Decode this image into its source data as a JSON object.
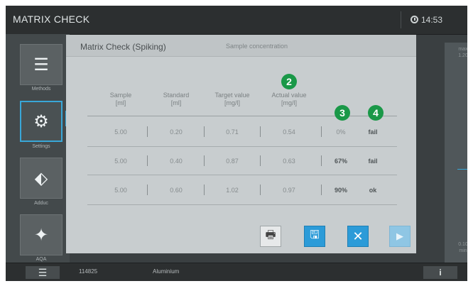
{
  "app": {
    "title": "MATRIX CHECK",
    "time": "14:53"
  },
  "sidebar": {
    "items": [
      {
        "label": "Methods",
        "icon": "list-icon",
        "glyph": "☰"
      },
      {
        "label": "Settings",
        "icon": "gear-icon",
        "glyph": "⚙"
      },
      {
        "label": "Adduc",
        "icon": "branch-icon",
        "glyph": "⬖"
      },
      {
        "label": "AQA",
        "icon": "sparkle-icon",
        "glyph": "✦"
      }
    ]
  },
  "panel": {
    "title": "Matrix Check (Spiking)",
    "subtitle": "Sample concentration"
  },
  "table": {
    "headers": [
      [
        "Sample",
        "[ml]"
      ],
      [
        "Standard",
        "[ml]"
      ],
      [
        "Target value",
        "[mg/l]"
      ],
      [
        "Actual value",
        "[mg/l]"
      ]
    ],
    "rows": [
      {
        "sample": "5.00",
        "standard": "0.20",
        "target": "0.71",
        "actual": "0.54",
        "recovery": "0%",
        "result": "fail"
      },
      {
        "sample": "5.00",
        "standard": "0.40",
        "target": "0.87",
        "actual": "0.63",
        "recovery": "67%",
        "result": "fail"
      },
      {
        "sample": "5.00",
        "standard": "0.60",
        "target": "1.02",
        "actual": "0.97",
        "recovery": "90%",
        "result": "ok"
      }
    ]
  },
  "badges": [
    "2",
    "3",
    "4"
  ],
  "buttons": {
    "print": {
      "icon": "print-icon",
      "glyph": "🖶"
    },
    "save": {
      "icon": "save-icon",
      "glyph": "🖫"
    },
    "cancel": {
      "icon": "close-icon",
      "glyph": "✕"
    },
    "next": {
      "icon": "play-icon",
      "glyph": "▶"
    }
  },
  "scale": {
    "max_label": "max",
    "max_value": "1.20",
    "min_value": "0.10",
    "min_label": "min"
  },
  "bottom": {
    "code": "114825",
    "parameter": "Aluminium",
    "info": "i",
    "menu_glyph": "☰"
  },
  "colors": {
    "accent": "#39a7d8",
    "badge": "#1a9848",
    "button_blue": "#2c9bd8"
  }
}
